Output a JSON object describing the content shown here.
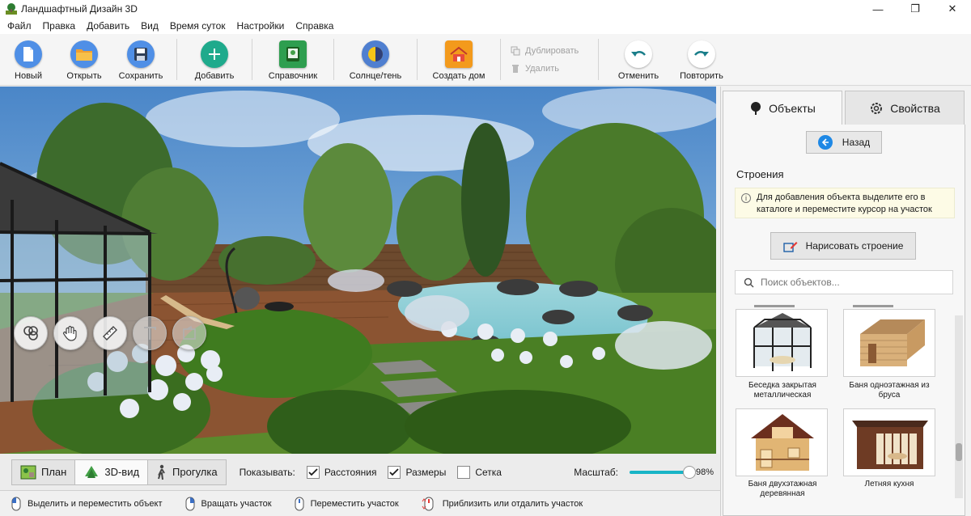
{
  "window": {
    "title": "Ландшафтный Дизайн 3D",
    "minimize": "—",
    "maximize": "❐",
    "close": "✕"
  },
  "menu": [
    "Файл",
    "Правка",
    "Добавить",
    "Вид",
    "Время суток",
    "Настройки",
    "Справка"
  ],
  "toolbar": {
    "new": "Новый",
    "open": "Открыть",
    "save": "Сохранить",
    "add": "Добавить",
    "reference": "Справочник",
    "sun_shadow": "Солнце/тень",
    "create_house": "Создать дом",
    "duplicate": "Дублировать",
    "delete": "Удалить",
    "undo": "Отменить",
    "redo": "Повторить"
  },
  "view_tools": [
    "objects-tool",
    "hand-tool",
    "ruler-tool",
    "text-tool",
    "area-tool"
  ],
  "view_tabs": [
    {
      "label": "План",
      "icon": "plan-icon",
      "active": false
    },
    {
      "label": "3D-вид",
      "icon": "3d-view-icon",
      "active": true
    },
    {
      "label": "Прогулка",
      "icon": "walk-icon",
      "active": false
    }
  ],
  "show": {
    "label": "Показывать:",
    "options": [
      {
        "label": "Расстояния",
        "checked": true
      },
      {
        "label": "Размеры",
        "checked": true
      },
      {
        "label": "Сетка",
        "checked": false
      }
    ]
  },
  "scale": {
    "label": "Масштаб:",
    "value": "98%",
    "fraction": 0.98
  },
  "status_hints": [
    "Выделить и переместить объект",
    "Вращать участок",
    "Переместить участок",
    "Приблизить или отдалить участок"
  ],
  "panel": {
    "tabs": [
      {
        "label": "Объекты",
        "icon": "tree-icon",
        "active": true
      },
      {
        "label": "Свойства",
        "icon": "gear-icon",
        "active": false
      }
    ],
    "back": "Назад",
    "section_title": "Строения",
    "info_text": "Для добавления объекта выделите его в каталоге и переместите курсор на участок",
    "draw_button": "Нарисовать строение",
    "search_placeholder": "Поиск объектов...",
    "items": [
      {
        "label": "Беседка закрытая металлическая",
        "icon": "gazebo-icon"
      },
      {
        "label": "Баня одноэтажная из бруса",
        "icon": "bathhouse-icon"
      },
      {
        "label": "Баня двухэтажная деревянная",
        "icon": "two-story-bathhouse-icon"
      },
      {
        "label": "Летняя кухня",
        "icon": "summer-kitchen-icon"
      }
    ]
  },
  "colors": {
    "accent": "#18b4c6",
    "new": "#4f8fe6",
    "open": "#f0a030",
    "save": "#3a7bd5",
    "add": "#1faa8c",
    "house": "#f39a1c",
    "undo": "#1bb8c8"
  }
}
